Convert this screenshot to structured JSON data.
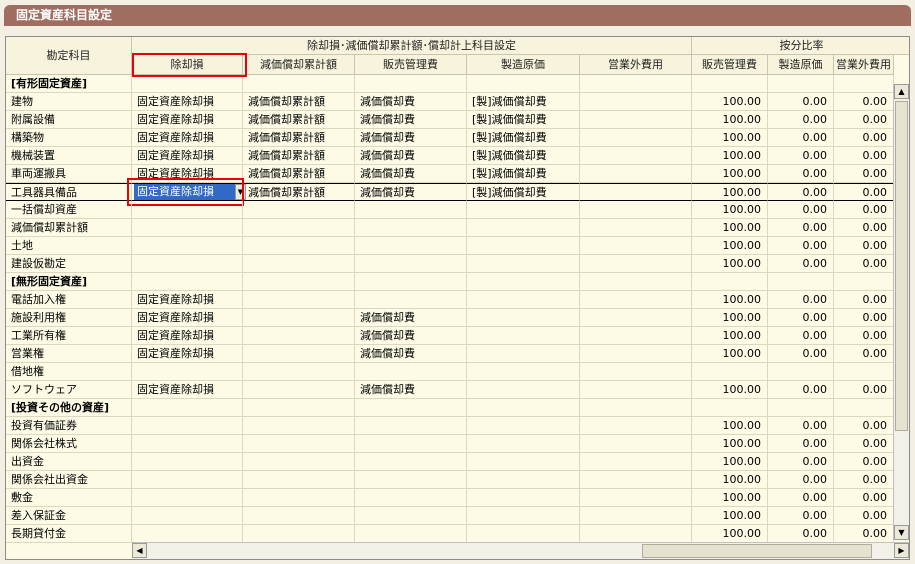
{
  "window": {
    "title": "固定資産科目設定"
  },
  "header": {
    "account_col": "勘定科目",
    "group1": "除却損･減価償却累計額･償却計上科目設定",
    "group2": "按分比率",
    "cols": [
      "除却損",
      "減価償却累計額",
      "販売管理費",
      "製造原価",
      "営業外費用",
      "販売管理費",
      "製造原価",
      "営業外費用"
    ]
  },
  "rows": [
    {
      "name": "[有形固定資産]",
      "section": true
    },
    {
      "name": "建物",
      "c": [
        "固定資産除却損",
        "減価償却累計額",
        "減価償却費",
        "[製]減価償却費",
        ""
      ],
      "r": [
        "100.00",
        "0.00",
        "0.00"
      ]
    },
    {
      "name": "附属設備",
      "c": [
        "固定資産除却損",
        "減価償却累計額",
        "減価償却費",
        "[製]減価償却費",
        ""
      ],
      "r": [
        "100.00",
        "0.00",
        "0.00"
      ]
    },
    {
      "name": "構築物",
      "c": [
        "固定資産除却損",
        "減価償却累計額",
        "減価償却費",
        "[製]減価償却費",
        ""
      ],
      "r": [
        "100.00",
        "0.00",
        "0.00"
      ]
    },
    {
      "name": "機械装置",
      "c": [
        "固定資産除却損",
        "減価償却累計額",
        "減価償却費",
        "[製]減価償却費",
        ""
      ],
      "r": [
        "100.00",
        "0.00",
        "0.00"
      ]
    },
    {
      "name": "車両運搬具",
      "c": [
        "固定資産除却損",
        "減価償却累計額",
        "減価償却費",
        "[製]減価償却費",
        ""
      ],
      "r": [
        "100.00",
        "0.00",
        "0.00"
      ]
    },
    {
      "name": "工具器具備品",
      "c": [
        "固定資産除却損",
        "減価償却累計額",
        "減価償却費",
        "[製]減価償却費",
        ""
      ],
      "r": [
        "100.00",
        "0.00",
        "0.00"
      ],
      "selected": true
    },
    {
      "name": "一括償却資産",
      "c": [
        "",
        "",
        "",
        "",
        ""
      ],
      "r": [
        "100.00",
        "0.00",
        "0.00"
      ]
    },
    {
      "name": "減価償却累計額",
      "c": [
        "",
        "",
        "",
        "",
        ""
      ],
      "r": [
        "100.00",
        "0.00",
        "0.00"
      ]
    },
    {
      "name": "土地",
      "c": [
        "",
        "",
        "",
        "",
        ""
      ],
      "r": [
        "100.00",
        "0.00",
        "0.00"
      ]
    },
    {
      "name": "建設仮勘定",
      "c": [
        "",
        "",
        "",
        "",
        ""
      ],
      "r": [
        "100.00",
        "0.00",
        "0.00"
      ]
    },
    {
      "name": "[無形固定資産]",
      "section": true
    },
    {
      "name": "電話加入権",
      "c": [
        "固定資産除却損",
        "",
        "",
        "",
        ""
      ],
      "r": [
        "100.00",
        "0.00",
        "0.00"
      ]
    },
    {
      "name": "施設利用権",
      "c": [
        "固定資産除却損",
        "",
        "減価償却費",
        "",
        ""
      ],
      "r": [
        "100.00",
        "0.00",
        "0.00"
      ]
    },
    {
      "name": "工業所有権",
      "c": [
        "固定資産除却損",
        "",
        "減価償却費",
        "",
        ""
      ],
      "r": [
        "100.00",
        "0.00",
        "0.00"
      ]
    },
    {
      "name": "営業権",
      "c": [
        "固定資産除却損",
        "",
        "減価償却費",
        "",
        ""
      ],
      "r": [
        "100.00",
        "0.00",
        "0.00"
      ]
    },
    {
      "name": "借地権",
      "c": [
        "",
        "",
        "",
        "",
        ""
      ],
      "r": [
        "",
        "",
        ""
      ]
    },
    {
      "name": "ソフトウェア",
      "c": [
        "固定資産除却損",
        "",
        "減価償却費",
        "",
        ""
      ],
      "r": [
        "100.00",
        "0.00",
        "0.00"
      ]
    },
    {
      "name": "[投資その他の資産]",
      "section": true
    },
    {
      "name": "投資有価証券",
      "c": [
        "",
        "",
        "",
        "",
        ""
      ],
      "r": [
        "100.00",
        "0.00",
        "0.00"
      ]
    },
    {
      "name": "関係会社株式",
      "c": [
        "",
        "",
        "",
        "",
        ""
      ],
      "r": [
        "100.00",
        "0.00",
        "0.00"
      ]
    },
    {
      "name": "出資金",
      "c": [
        "",
        "",
        "",
        "",
        ""
      ],
      "r": [
        "100.00",
        "0.00",
        "0.00"
      ]
    },
    {
      "name": "関係会社出資金",
      "c": [
        "",
        "",
        "",
        "",
        ""
      ],
      "r": [
        "100.00",
        "0.00",
        "0.00"
      ]
    },
    {
      "name": "敷金",
      "c": [
        "",
        "",
        "",
        "",
        ""
      ],
      "r": [
        "100.00",
        "0.00",
        "0.00"
      ]
    },
    {
      "name": "差入保証金",
      "c": [
        "",
        "",
        "",
        "",
        ""
      ],
      "r": [
        "100.00",
        "0.00",
        "0.00"
      ]
    },
    {
      "name": "長期貸付金",
      "c": [
        "",
        "",
        "",
        "",
        ""
      ],
      "r": [
        "100.00",
        "0.00",
        "0.00"
      ]
    }
  ],
  "icons": {
    "dropdown": "dropdown-arrow-icon",
    "up": "scroll-up-icon",
    "down": "scroll-down-icon",
    "left": "scroll-left-icon",
    "right": "scroll-right-icon"
  }
}
